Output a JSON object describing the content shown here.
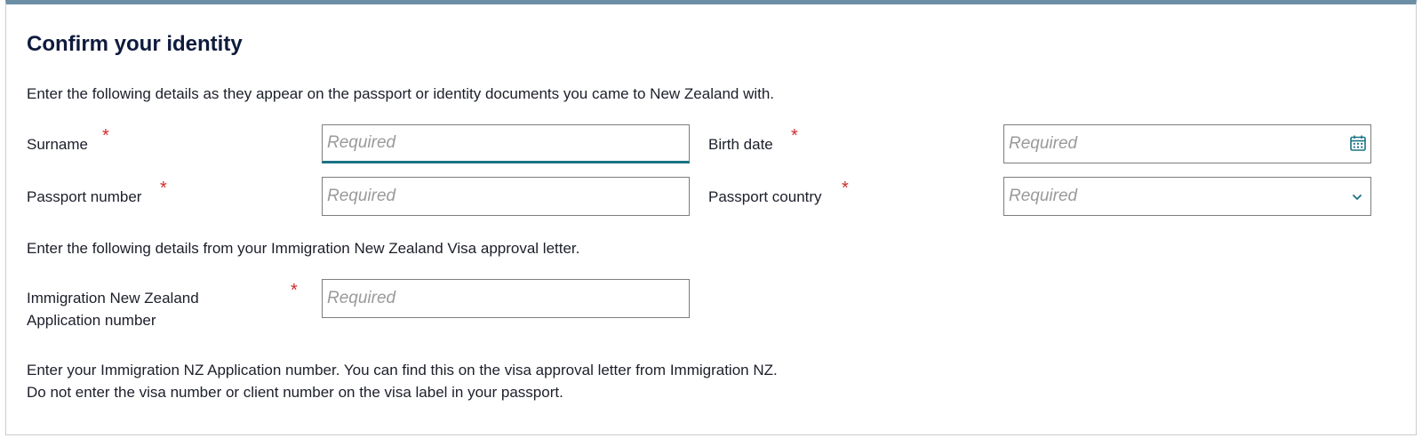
{
  "form": {
    "title": "Confirm your identity",
    "intro_passport": "Enter the following details as they appear on the passport or identity documents you came to New Zealand with.",
    "intro_visa": "Enter the following details from your Immigration New Zealand Visa approval letter.",
    "required_marker": "*",
    "fields": {
      "surname": {
        "label": "Surname",
        "placeholder": "Required"
      },
      "birth_date": {
        "label": "Birth date",
        "placeholder": "Required",
        "icon": "calendar-icon"
      },
      "passport_number": {
        "label": "Passport number",
        "placeholder": "Required"
      },
      "passport_country": {
        "label": "Passport country",
        "selected": "Required",
        "icon": "chevron-down-icon"
      },
      "application_number": {
        "label_line1": "Immigration New Zealand",
        "label_line2": "Application number",
        "placeholder": "Required"
      }
    },
    "help_line1": "Enter your Immigration NZ Application number. You can find this on the visa approval letter from Immigration NZ.",
    "help_line2": "Do not enter the visa number or client number on the visa label in your passport."
  },
  "colors": {
    "accent": "#1a7383",
    "top_border": "#6c8fa6",
    "required": "#d12a2a",
    "title": "#0f1b3d"
  }
}
